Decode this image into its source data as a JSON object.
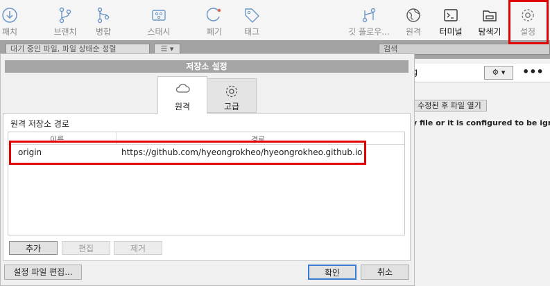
{
  "toolbar": {
    "items": [
      {
        "label": "패치",
        "icon": "patch-icon"
      },
      {
        "label": "브랜치",
        "icon": "branch-icon"
      },
      {
        "label": "병합",
        "icon": "merge-icon"
      },
      {
        "label": "스태시",
        "icon": "stash-icon"
      },
      {
        "label": "폐기",
        "icon": "discard-icon"
      },
      {
        "label": "태그",
        "icon": "tag-icon"
      },
      {
        "label": "깃 플로우...",
        "icon": "git-flow-icon"
      },
      {
        "label": "원격",
        "icon": "remote-icon"
      },
      {
        "label": "터미널",
        "icon": "terminal-icon"
      },
      {
        "label": "탐색기",
        "icon": "explorer-icon"
      },
      {
        "label": "설정",
        "icon": "settings-icon"
      }
    ]
  },
  "background": {
    "filter_left": "대기 중인 파일, 파일 상태순 정렬",
    "search_placeholder": "검색",
    "right_fragment": "g",
    "open_button": "수정된 후 파일 열기",
    "message_fragment": "y file or it is configured to be ignor"
  },
  "dialog": {
    "title": "저장소 설정",
    "tabs": [
      {
        "label": "원격",
        "icon": "cloud-icon",
        "selected": true
      },
      {
        "label": "고급",
        "icon": "gear-icon",
        "selected": false
      }
    ],
    "section_title": "원격 저장소 경로",
    "columns": [
      "이름",
      "경로"
    ],
    "remotes": [
      {
        "name": "origin",
        "path": "https://github.com/hyeongrokheo/hyeongrokheo.github.io"
      }
    ],
    "buttons": {
      "add": "추가",
      "edit": "편집",
      "remove": "제거",
      "edit_config": "설정 파일 편집...",
      "ok": "확인",
      "cancel": "취소"
    }
  },
  "colors": {
    "highlight": "#e00000",
    "toolbar_icon": "#6b97c8"
  }
}
